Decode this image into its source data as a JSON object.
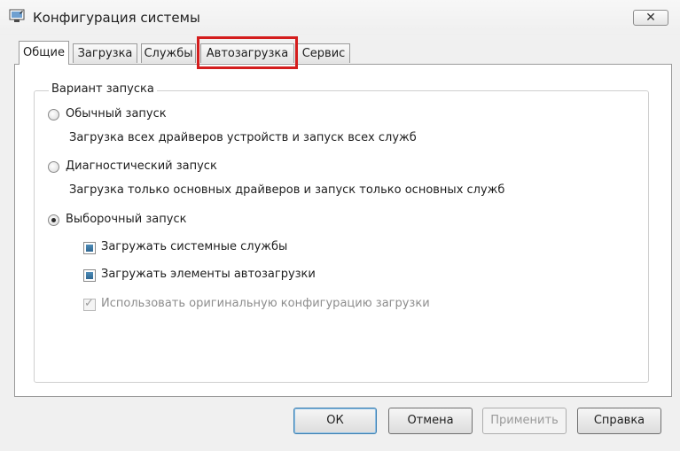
{
  "window": {
    "title": "Конфигурация системы",
    "close_label": "✕"
  },
  "tabs": [
    {
      "label": "Общие"
    },
    {
      "label": "Загрузка"
    },
    {
      "label": "Службы"
    },
    {
      "label": "Автозагрузка"
    },
    {
      "label": "Сервис"
    }
  ],
  "active_tab": "Общие",
  "highlighted_tab": "Автозагрузка",
  "startup": {
    "group_title": "Вариант запуска",
    "normal": {
      "label": "Обычный запуск",
      "description": "Загрузка всех драйверов устройств и запуск всех служб",
      "checked": false
    },
    "diagnostic": {
      "label": "Диагностический запуск",
      "description": "Загрузка только основных драйверов и запуск только основных служб",
      "checked": false
    },
    "selective": {
      "label": "Выборочный запуск",
      "checked": true,
      "options": [
        {
          "label": "Загружать системные службы",
          "state": "indeterminate"
        },
        {
          "label": "Загружать элементы автозагрузки",
          "state": "indeterminate"
        },
        {
          "label": "Использовать оригинальную конфигурацию загрузки",
          "state": "checked-disabled"
        }
      ]
    }
  },
  "buttons": {
    "ok": "ОК",
    "cancel": "Отмена",
    "apply": "Применить",
    "help": "Справка"
  },
  "colors": {
    "highlight": "#d41d1d",
    "checkbox_fill": "#2f6792"
  }
}
